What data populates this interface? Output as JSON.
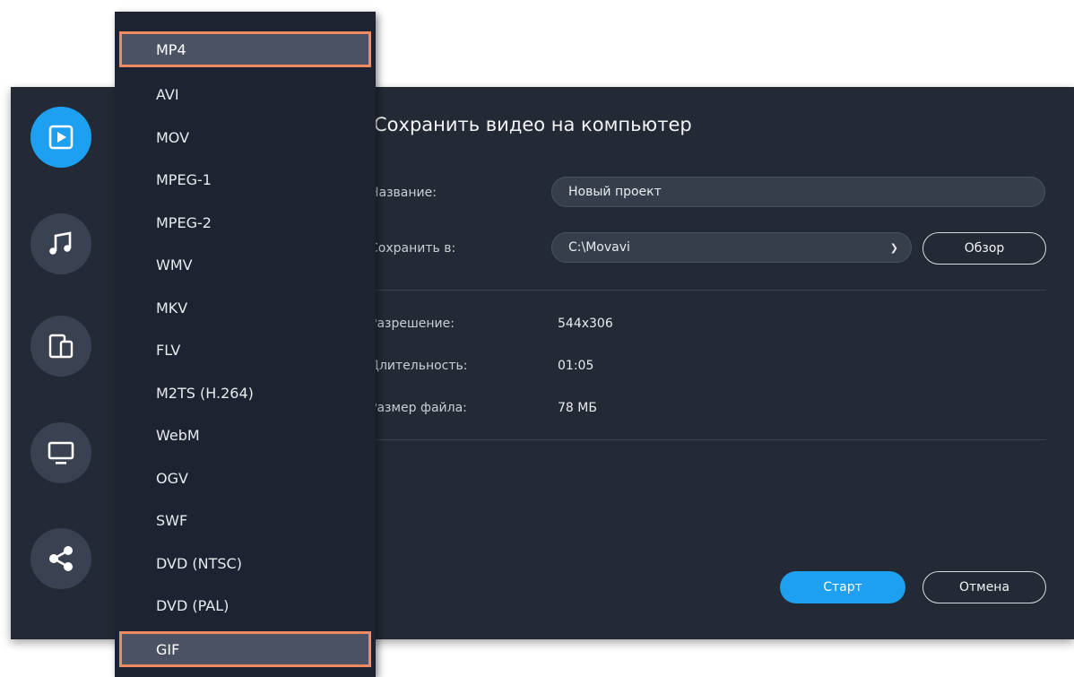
{
  "dialog": {
    "title": "Сохранить видео на компьютер",
    "name_label": "Название:",
    "name_value": "Новый проект",
    "save_to_label": "Сохранить в:",
    "save_to_value": "C:\\Movavi",
    "browse_label": "Обзор",
    "resolution_label": "Разрешение:",
    "resolution_value": "544x306",
    "duration_label": "Длительность:",
    "duration_value": "01:05",
    "filesize_label": "Размер файла:",
    "filesize_value": "78 МБ",
    "start_label": "Старт",
    "cancel_label": "Отмена"
  },
  "categories": [
    {
      "icon": "video-file-icon",
      "active": true
    },
    {
      "icon": "music-note-icon",
      "active": false
    },
    {
      "icon": "devices-icon",
      "active": false
    },
    {
      "icon": "monitor-icon",
      "active": false
    },
    {
      "icon": "share-icon",
      "active": false
    }
  ],
  "formats": {
    "items": [
      "MP4",
      "AVI",
      "MOV",
      "MPEG-1",
      "MPEG-2",
      "WMV",
      "MKV",
      "FLV",
      "M2TS (H.264)",
      "WebM",
      "OGV",
      "SWF",
      "DVD (NTSC)",
      "DVD (PAL)",
      "GIF"
    ],
    "highlighted": [
      "MP4",
      "GIF"
    ]
  },
  "colors": {
    "accent": "#1ea0f0",
    "highlight_border": "#f08a60",
    "background": "#242a35",
    "dropdown_bg": "#1d2330"
  }
}
